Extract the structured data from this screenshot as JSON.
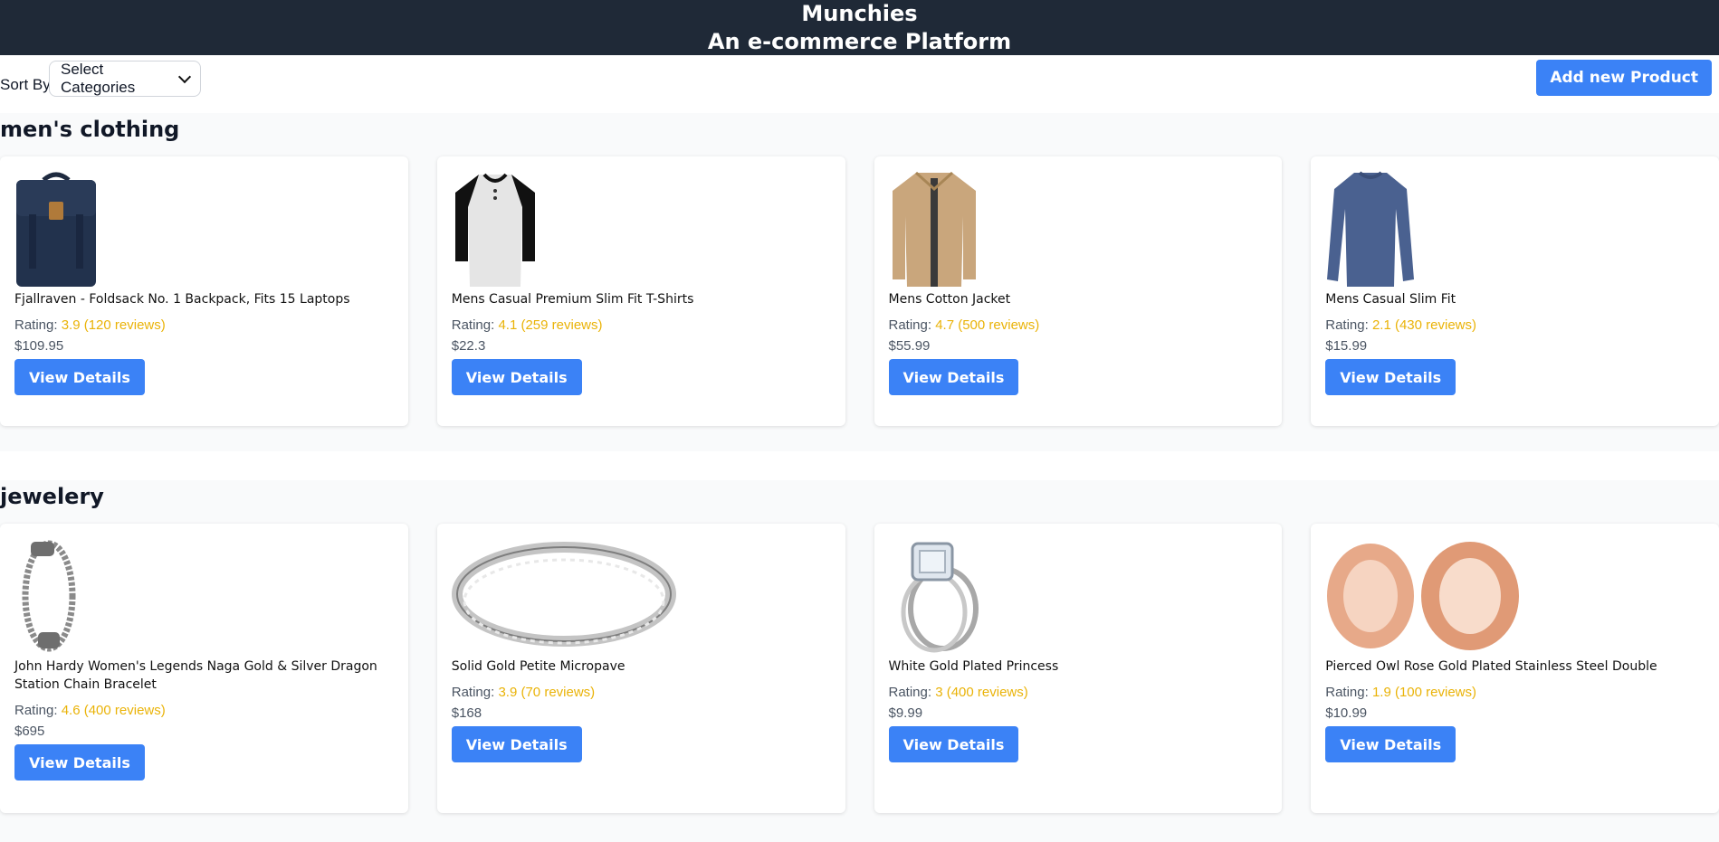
{
  "header": {
    "title": "Munchies",
    "subtitle": "An e-commerce Platform"
  },
  "toolbar": {
    "sort_label": "Sort By:",
    "select_value": "Select Categories",
    "add_label": "Add new Product"
  },
  "sections": [
    {
      "title": "men's clothing",
      "products": [
        {
          "name": "Fjallraven - Foldsack No. 1 Backpack, Fits 15 Laptops",
          "rating_label": "Rating:",
          "rating": "3.9 (120 reviews)",
          "price": "$109.95",
          "button": "View Details",
          "icon": "backpack-image"
        },
        {
          "name": "Mens Casual Premium Slim Fit T-Shirts",
          "rating_label": "Rating:",
          "rating": "4.1 (259 reviews)",
          "price": "$22.3",
          "button": "View Details",
          "icon": "tshirt-image"
        },
        {
          "name": "Mens Cotton Jacket",
          "rating_label": "Rating:",
          "rating": "4.7 (500 reviews)",
          "price": "$55.99",
          "button": "View Details",
          "icon": "jacket-image"
        },
        {
          "name": "Mens Casual Slim Fit",
          "rating_label": "Rating:",
          "rating": "2.1 (430 reviews)",
          "price": "$15.99",
          "button": "View Details",
          "icon": "longsleeve-image"
        }
      ]
    },
    {
      "title": "jewelery",
      "products": [
        {
          "name": "John Hardy Women's Legends Naga Gold & Silver Dragon Station Chain Bracelet",
          "rating_label": "Rating:",
          "rating": "4.6 (400 reviews)",
          "price": "$695",
          "button": "View Details",
          "icon": "bracelet-image"
        },
        {
          "name": "Solid Gold Petite Micropave",
          "rating_label": "Rating:",
          "rating": "3.9 (70 reviews)",
          "price": "$168",
          "button": "View Details",
          "icon": "ring-image"
        },
        {
          "name": "White Gold Plated Princess",
          "rating_label": "Rating:",
          "rating": "3 (400 reviews)",
          "price": "$9.99",
          "button": "View Details",
          "icon": "engagement-ring-image"
        },
        {
          "name": "Pierced Owl Rose Gold Plated Stainless Steel Double",
          "rating_label": "Rating:",
          "rating": "1.9 (100 reviews)",
          "price": "$10.99",
          "button": "View Details",
          "icon": "plugs-image"
        }
      ]
    }
  ],
  "colors": {
    "header_bg": "#1f2937",
    "accent": "#3b82f6",
    "rating": "#eab308",
    "section_bg": "#f9fafb"
  }
}
